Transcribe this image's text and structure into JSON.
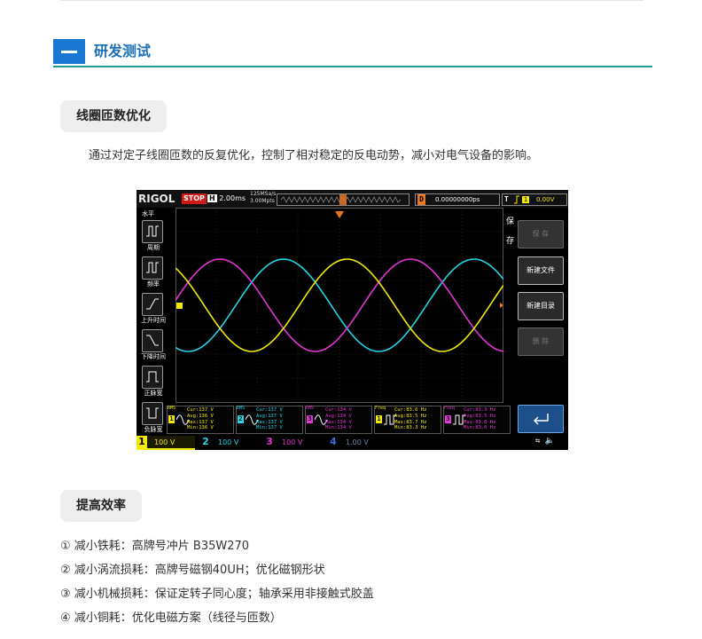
{
  "section": {
    "title": "研发测试"
  },
  "blocks": {
    "coil": {
      "title": "线圈匝数优化",
      "text": "通过对定子线圈匝数的反复优化，控制了相对稳定的反电动势，减小对电气设备的影响。"
    },
    "efficiency": {
      "title": "提高效率",
      "items": [
        "① 减小铁耗：高牌号冲片 B35W270",
        "② 减小涡流损耗：高牌号磁钢40UH；优化磁钢形状",
        "③ 减小机械损耗：保证定转子同心度；轴承采用非接触式胶盖",
        "④ 减小铜耗：优化电磁方案（线径与匝数）"
      ]
    }
  },
  "scope": {
    "brand": "RIGOL",
    "state": "STOP",
    "timebase_key": "H",
    "timebase": "2.00ms",
    "sample_rate": "125MSa/s",
    "mem_depth": "3.00Mpts",
    "delay_key": "D",
    "delay": "0.00000000ps",
    "trigger_key": "T",
    "trigger_level": "0.00V",
    "left_menu": {
      "title": "水平",
      "items": [
        "周期",
        "频率",
        "上升时间",
        "下降时间",
        "正脉宽",
        "负脉宽"
      ]
    },
    "right_menu": {
      "title": "保存",
      "buttons": [
        "保 存",
        "新建文件",
        "新建目录",
        "删 除"
      ]
    },
    "measurements": [
      {
        "tag": "RMS",
        "num": "1",
        "lines": "Cur:137 V\nAvg:136 V\nMax:137 V\nMin:136 V",
        "color": "#f2ea00"
      },
      {
        "tag": "RMS",
        "num": "2",
        "lines": "Cur:137 V\nAvg:137 V\nMax:137 V\nMin:137 V",
        "color": "#22d6e6"
      },
      {
        "tag": "RMS",
        "num": "3",
        "lines": "Cur:134 V\nAvg:134 V\nMax:134 V\nMin:134 V",
        "color": "#e334d6"
      },
      {
        "tag": "Freq",
        "num": "1",
        "lines": "Cur:83.6 Hz\nAvg:83.5 Hz\nMax:83.7 Hz\nMin:83.3 Hz",
        "color": "#f2ea00"
      },
      {
        "tag": "Freq",
        "num": "3",
        "lines": "Cur:83.3 Hz\nAvg:83.5 Hz\nMax:83.8 Hz\nMin:83.0 Hz",
        "color": "#e334d6"
      }
    ],
    "channels": [
      {
        "n": "1",
        "scale": "100 V",
        "color": "#f2ea00"
      },
      {
        "n": "2",
        "scale": "100 V",
        "color": "#22d6e6"
      },
      {
        "n": "3",
        "scale": "100 V",
        "color": "#e334d6"
      },
      {
        "n": "4",
        "scale": "1.00 V",
        "color": "#3d6ee0"
      }
    ],
    "trace_colors": {
      "ch1": "#f2ea00",
      "ch2": "#22d6e6",
      "ch3": "#e334d6"
    }
  },
  "colors": {
    "accent_blue": "#1a78d2",
    "rule_teal": "#1f9a8f",
    "heading_blue": "#1a6fb8"
  }
}
